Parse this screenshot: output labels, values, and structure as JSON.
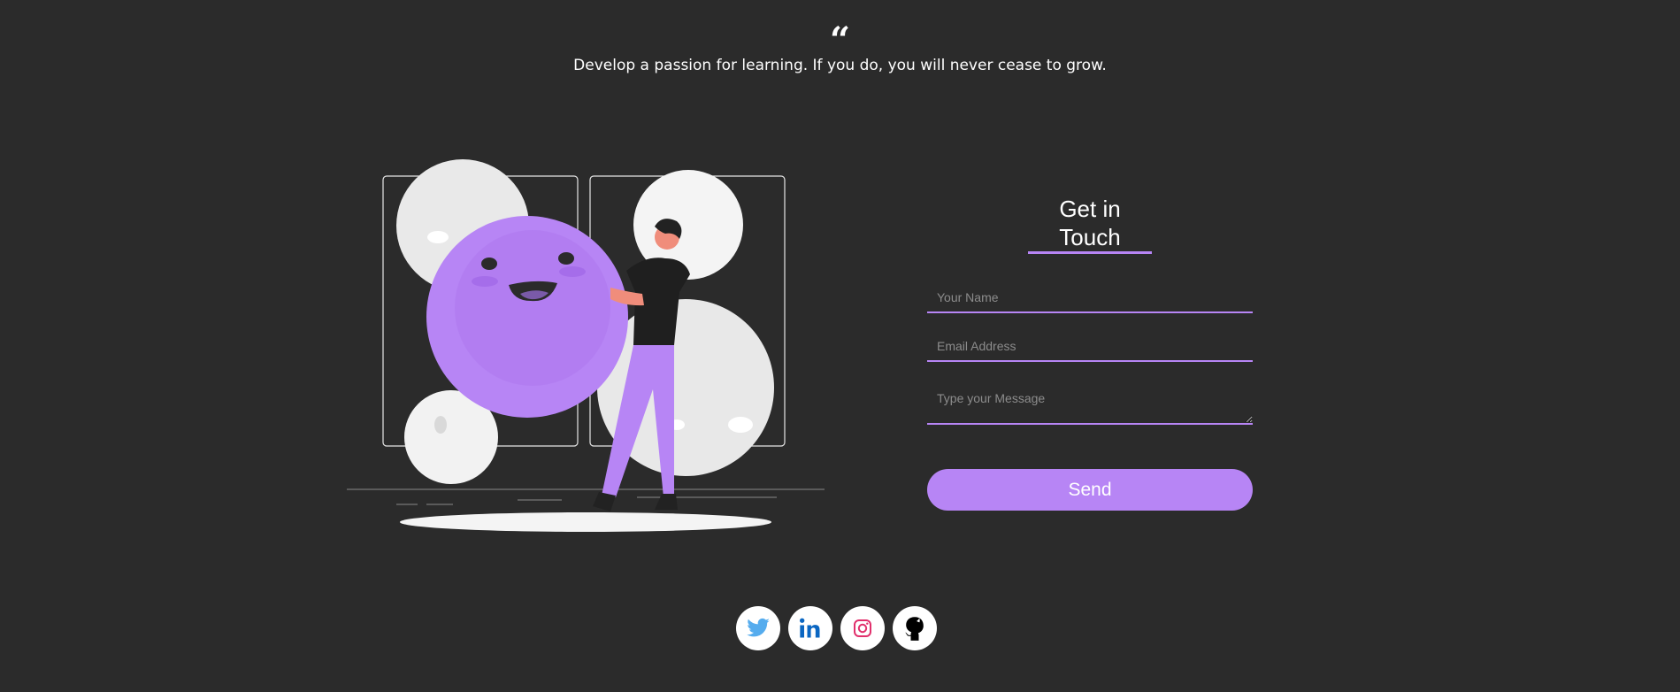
{
  "quote": {
    "mark": "“",
    "text": "Develop a passion for learning. If you do, you will never cease to grow."
  },
  "contact": {
    "title": "Get in Touch",
    "name_placeholder": "Your Name",
    "email_placeholder": "Email Address",
    "message_placeholder": "Type your Message",
    "send_label": "Send"
  },
  "socials": [
    {
      "icon": "twitter-icon",
      "color": "#55acee"
    },
    {
      "icon": "linkedin-icon",
      "color": "#0a66c2"
    },
    {
      "icon": "instagram-icon",
      "color": "#e1306c"
    },
    {
      "icon": "github-icon",
      "color": "#000000"
    }
  ],
  "colors": {
    "accent": "#b785f5",
    "background": "#2b2b2b"
  }
}
